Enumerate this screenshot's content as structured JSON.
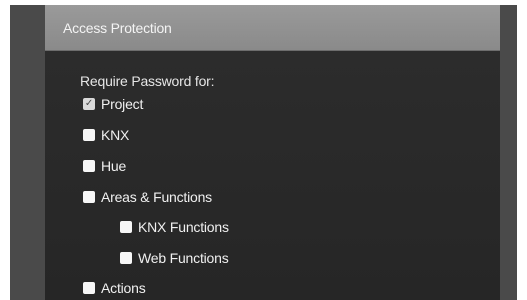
{
  "panel": {
    "title": "Access Protection"
  },
  "section": {
    "label": "Require Password for:"
  },
  "options": [
    {
      "label": "Project",
      "checked": true
    },
    {
      "label": "KNX",
      "checked": false
    },
    {
      "label": "Hue",
      "checked": false
    },
    {
      "label": "Areas & Functions",
      "checked": false
    },
    {
      "label": "KNX Functions",
      "checked": false
    },
    {
      "label": "Web Functions",
      "checked": false
    },
    {
      "label": "Actions",
      "checked": false
    }
  ],
  "icons": {
    "checkmark": "check-icon"
  },
  "colors": {
    "header": "#8f8f8f",
    "panel": "#2a2a2a",
    "frame": "#4a4a4a"
  }
}
